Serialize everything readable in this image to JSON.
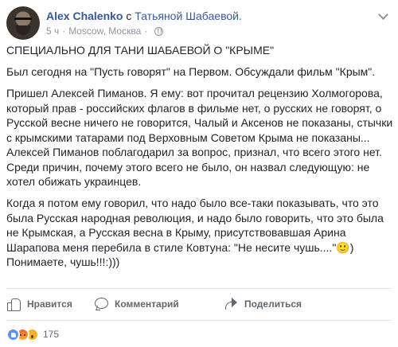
{
  "post": {
    "author": "Alex Chalenko",
    "with_word": "с",
    "tagged": "Татьяной Шабаевой.",
    "time": "5 ч",
    "separator": "·",
    "location": "Moscow, Москва",
    "paragraphs": [
      "СПЕЦИАЛЬНО ДЛЯ ТАНИ ШАБАЕВОЙ О \"КРЫМЕ\"",
      "Был сегодня на \"Пусть говорят\" на Первом. Обсуждали фильм \"Крым\".",
      "Пришел Алексей Пиманов. Я ему: вот прочитал рецензию Холмогорова, который прав - российских флагов в фильме нет, о русских не говорят, о Русской весне ничего не говорится, Чалый и Аксенов не показаны, стычки с крымскими татарами под Верховным Советом Крыма не показаны... Алексей Пиманов поблагодарил за вопрос, признал, что всего этого нет. Среди причин, почему этого всего не было, он назвал следующую: не хотел обижать украинцев.",
      "Когда я потом ему говорил, что надо было все-таки показывать, что это была Русская народная революция, и надо было говорить, что это была не Крымская, а Русская весна в Крыму, присутствовавшая Арина Шарапова меня перебила в стиле Ковтуна: \"Не несите чушь....\"🙂) Понимаете, чушь!!!:)))"
    ]
  },
  "actions": {
    "like": "Нравится",
    "comment": "Комментарий",
    "share": "Поделиться"
  },
  "reactions": {
    "count": "175",
    "icons": [
      "like-icon",
      "angry-icon",
      "wow-icon"
    ]
  },
  "colors": {
    "link": "#365899",
    "meta": "#90949c",
    "action": "#606770"
  }
}
